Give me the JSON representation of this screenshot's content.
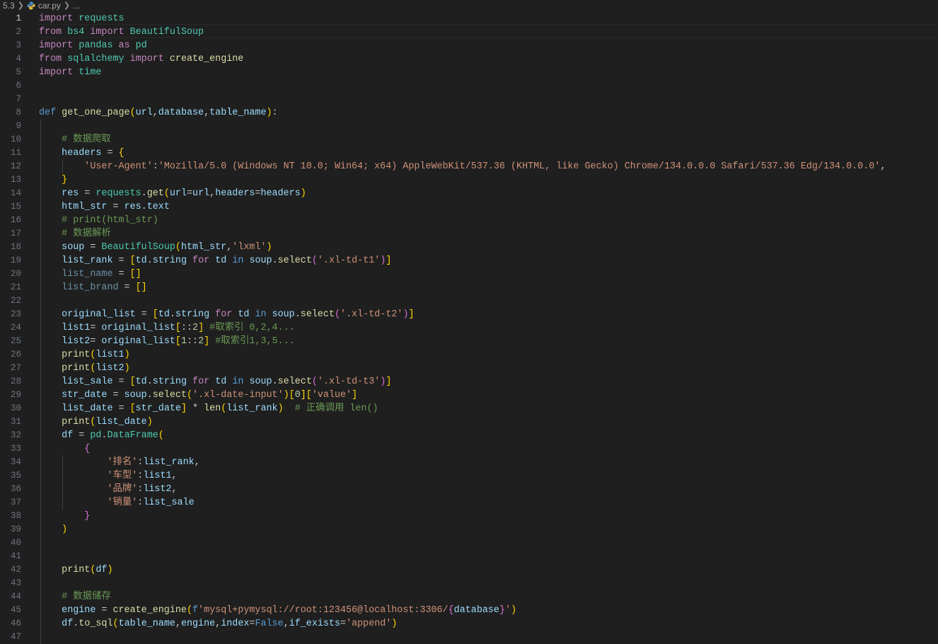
{
  "breadcrumb": {
    "folder": "5.3",
    "file": "car.py",
    "tail": "..."
  },
  "editor": {
    "active_line": 1,
    "line_numbers": [
      "1",
      "2",
      "3",
      "4",
      "5",
      "6",
      "7",
      "8",
      "9",
      "10",
      "11",
      "12",
      "13",
      "14",
      "15",
      "16",
      "17",
      "18",
      "19",
      "20",
      "21",
      "22",
      "23",
      "24",
      "25",
      "26",
      "27",
      "28",
      "29",
      "30",
      "31",
      "32",
      "33",
      "34",
      "35",
      "36",
      "37",
      "38",
      "39",
      "40",
      "41",
      "42",
      "43",
      "44",
      "45",
      "46",
      "47"
    ],
    "lines": [
      [
        [
          "kwc",
          "import"
        ],
        [
          "tx",
          " "
        ],
        [
          "mod",
          "requests"
        ]
      ],
      [
        [
          "kwc",
          "from"
        ],
        [
          "tx",
          " "
        ],
        [
          "mod",
          "bs4"
        ],
        [
          "tx",
          " "
        ],
        [
          "kwc",
          "import"
        ],
        [
          "tx",
          " "
        ],
        [
          "mod",
          "BeautifulSoup"
        ]
      ],
      [
        [
          "kwc",
          "import"
        ],
        [
          "tx",
          " "
        ],
        [
          "mod",
          "pandas"
        ],
        [
          "tx",
          " "
        ],
        [
          "kwc",
          "as"
        ],
        [
          "tx",
          " "
        ],
        [
          "mod",
          "pd"
        ]
      ],
      [
        [
          "kwc",
          "from"
        ],
        [
          "tx",
          " "
        ],
        [
          "mod",
          "sqlalchemy"
        ],
        [
          "tx",
          " "
        ],
        [
          "kwc",
          "import"
        ],
        [
          "tx",
          " "
        ],
        [
          "fn",
          "create_engine"
        ]
      ],
      [
        [
          "kwc",
          "import"
        ],
        [
          "tx",
          " "
        ],
        [
          "mod",
          "time"
        ]
      ],
      [],
      [],
      [
        [
          "kw",
          "def"
        ],
        [
          "tx",
          " "
        ],
        [
          "fn",
          "get_one_page"
        ],
        [
          "p1",
          "("
        ],
        [
          "var",
          "url"
        ],
        [
          "tx",
          ","
        ],
        [
          "var",
          "database"
        ],
        [
          "tx",
          ","
        ],
        [
          "var",
          "table_name"
        ],
        [
          "p1",
          ")"
        ],
        [
          "tx",
          ":"
        ]
      ],
      [],
      [
        [
          "tx",
          "    "
        ],
        [
          "cm",
          "# 数据爬取"
        ]
      ],
      [
        [
          "tx",
          "    "
        ],
        [
          "var",
          "headers"
        ],
        [
          "tx",
          " = "
        ],
        [
          "p1",
          "{"
        ]
      ],
      [
        [
          "tx",
          "        "
        ],
        [
          "str",
          "'User-Agent'"
        ],
        [
          "tx",
          ":"
        ],
        [
          "str",
          "'Mozilla/5.0 (Windows NT 10.0; Win64; x64) AppleWebKit/537.36 (KHTML, like Gecko) Chrome/134.0.0.0 Safari/537.36 Edg/134.0.0.0'"
        ],
        [
          "tx",
          ","
        ]
      ],
      [
        [
          "tx",
          "    "
        ],
        [
          "p1",
          "}"
        ]
      ],
      [
        [
          "tx",
          "    "
        ],
        [
          "var",
          "res"
        ],
        [
          "tx",
          " = "
        ],
        [
          "mod",
          "requests"
        ],
        [
          "tx",
          "."
        ],
        [
          "fn",
          "get"
        ],
        [
          "p1",
          "("
        ],
        [
          "var",
          "url"
        ],
        [
          "tx",
          "="
        ],
        [
          "var",
          "url"
        ],
        [
          "tx",
          ","
        ],
        [
          "var",
          "headers"
        ],
        [
          "tx",
          "="
        ],
        [
          "var",
          "headers"
        ],
        [
          "p1",
          ")"
        ]
      ],
      [
        [
          "tx",
          "    "
        ],
        [
          "var",
          "html_str"
        ],
        [
          "tx",
          " = "
        ],
        [
          "var",
          "res"
        ],
        [
          "tx",
          "."
        ],
        [
          "var",
          "text"
        ]
      ],
      [
        [
          "tx",
          "    "
        ],
        [
          "cm",
          "# print(html_str)"
        ]
      ],
      [
        [
          "tx",
          "    "
        ],
        [
          "cm",
          "# 数据解析"
        ]
      ],
      [
        [
          "tx",
          "    "
        ],
        [
          "var",
          "soup"
        ],
        [
          "tx",
          " = "
        ],
        [
          "mod",
          "BeautifulSoup"
        ],
        [
          "p1",
          "("
        ],
        [
          "var",
          "html_str"
        ],
        [
          "tx",
          ","
        ],
        [
          "str",
          "'lxml'"
        ],
        [
          "p1",
          ")"
        ]
      ],
      [
        [
          "tx",
          "    "
        ],
        [
          "var",
          "list_rank"
        ],
        [
          "tx",
          " = "
        ],
        [
          "p1",
          "["
        ],
        [
          "var",
          "td"
        ],
        [
          "tx",
          "."
        ],
        [
          "var",
          "string"
        ],
        [
          "tx",
          " "
        ],
        [
          "kwc",
          "for"
        ],
        [
          "tx",
          " "
        ],
        [
          "var",
          "td"
        ],
        [
          "tx",
          " "
        ],
        [
          "kw",
          "in"
        ],
        [
          "tx",
          " "
        ],
        [
          "var",
          "soup"
        ],
        [
          "tx",
          "."
        ],
        [
          "fn",
          "select"
        ],
        [
          "p2",
          "("
        ],
        [
          "str",
          "'.xl-td-t1'"
        ],
        [
          "p2",
          ")"
        ],
        [
          "p1",
          "]"
        ]
      ],
      [
        [
          "tx",
          "    "
        ],
        [
          "dim",
          "list_name"
        ],
        [
          "tx",
          " = "
        ],
        [
          "p1",
          "[]"
        ]
      ],
      [
        [
          "tx",
          "    "
        ],
        [
          "dim",
          "list_brand"
        ],
        [
          "tx",
          " = "
        ],
        [
          "p1",
          "[]"
        ]
      ],
      [],
      [
        [
          "tx",
          "    "
        ],
        [
          "var",
          "original_list"
        ],
        [
          "tx",
          " = "
        ],
        [
          "p1",
          "["
        ],
        [
          "var",
          "td"
        ],
        [
          "tx",
          "."
        ],
        [
          "var",
          "string"
        ],
        [
          "tx",
          " "
        ],
        [
          "kwc",
          "for"
        ],
        [
          "tx",
          " "
        ],
        [
          "var",
          "td"
        ],
        [
          "tx",
          " "
        ],
        [
          "kw",
          "in"
        ],
        [
          "tx",
          " "
        ],
        [
          "var",
          "soup"
        ],
        [
          "tx",
          "."
        ],
        [
          "fn",
          "select"
        ],
        [
          "p2",
          "("
        ],
        [
          "str",
          "'.xl-td-t2'"
        ],
        [
          "p2",
          ")"
        ],
        [
          "p1",
          "]"
        ]
      ],
      [
        [
          "tx",
          "    "
        ],
        [
          "var",
          "list1"
        ],
        [
          "tx",
          "= "
        ],
        [
          "var",
          "original_list"
        ],
        [
          "p1",
          "["
        ],
        [
          "tx",
          "::"
        ],
        [
          "num",
          "2"
        ],
        [
          "p1",
          "]"
        ],
        [
          "tx",
          " "
        ],
        [
          "cm",
          "#取索引 0,2,4..."
        ]
      ],
      [
        [
          "tx",
          "    "
        ],
        [
          "var",
          "list2"
        ],
        [
          "tx",
          "= "
        ],
        [
          "var",
          "original_list"
        ],
        [
          "p1",
          "["
        ],
        [
          "num",
          "1"
        ],
        [
          "tx",
          "::"
        ],
        [
          "num",
          "2"
        ],
        [
          "p1",
          "]"
        ],
        [
          "tx",
          " "
        ],
        [
          "cm",
          "#取索引1,3,5..."
        ]
      ],
      [
        [
          "tx",
          "    "
        ],
        [
          "fn",
          "print"
        ],
        [
          "p1",
          "("
        ],
        [
          "var",
          "list1"
        ],
        [
          "p1",
          ")"
        ]
      ],
      [
        [
          "tx",
          "    "
        ],
        [
          "fn",
          "print"
        ],
        [
          "p1",
          "("
        ],
        [
          "var",
          "list2"
        ],
        [
          "p1",
          ")"
        ]
      ],
      [
        [
          "tx",
          "    "
        ],
        [
          "var",
          "list_sale"
        ],
        [
          "tx",
          " = "
        ],
        [
          "p1",
          "["
        ],
        [
          "var",
          "td"
        ],
        [
          "tx",
          "."
        ],
        [
          "var",
          "string"
        ],
        [
          "tx",
          " "
        ],
        [
          "kwc",
          "for"
        ],
        [
          "tx",
          " "
        ],
        [
          "var",
          "td"
        ],
        [
          "tx",
          " "
        ],
        [
          "kw",
          "in"
        ],
        [
          "tx",
          " "
        ],
        [
          "var",
          "soup"
        ],
        [
          "tx",
          "."
        ],
        [
          "fn",
          "select"
        ],
        [
          "p2",
          "("
        ],
        [
          "str",
          "'.xl-td-t3'"
        ],
        [
          "p2",
          ")"
        ],
        [
          "p1",
          "]"
        ]
      ],
      [
        [
          "tx",
          "    "
        ],
        [
          "var",
          "str_date"
        ],
        [
          "tx",
          " = "
        ],
        [
          "var",
          "soup"
        ],
        [
          "tx",
          "."
        ],
        [
          "fn",
          "select"
        ],
        [
          "p1",
          "("
        ],
        [
          "str",
          "'.xl-date-input'"
        ],
        [
          "p1",
          ")"
        ],
        [
          "p1",
          "["
        ],
        [
          "num",
          "0"
        ],
        [
          "p1",
          "]"
        ],
        [
          "p1",
          "["
        ],
        [
          "str",
          "'value'"
        ],
        [
          "p1",
          "]"
        ]
      ],
      [
        [
          "tx",
          "    "
        ],
        [
          "var",
          "list_date"
        ],
        [
          "tx",
          " = "
        ],
        [
          "p1",
          "["
        ],
        [
          "var",
          "str_date"
        ],
        [
          "p1",
          "]"
        ],
        [
          "tx",
          " * "
        ],
        [
          "fn",
          "len"
        ],
        [
          "p1",
          "("
        ],
        [
          "var",
          "list_rank"
        ],
        [
          "p1",
          ")"
        ],
        [
          "tx",
          "  "
        ],
        [
          "cm",
          "# 正确调用 len()"
        ]
      ],
      [
        [
          "tx",
          "    "
        ],
        [
          "fn",
          "print"
        ],
        [
          "p1",
          "("
        ],
        [
          "var",
          "list_date"
        ],
        [
          "p1",
          ")"
        ]
      ],
      [
        [
          "tx",
          "    "
        ],
        [
          "var",
          "df"
        ],
        [
          "tx",
          " = "
        ],
        [
          "mod",
          "pd"
        ],
        [
          "tx",
          "."
        ],
        [
          "mod",
          "DataFrame"
        ],
        [
          "p1",
          "("
        ]
      ],
      [
        [
          "tx",
          "        "
        ],
        [
          "p2",
          "{"
        ]
      ],
      [
        [
          "tx",
          "            "
        ],
        [
          "str",
          "'排名'"
        ],
        [
          "tx",
          ":"
        ],
        [
          "var",
          "list_rank"
        ],
        [
          "tx",
          ","
        ]
      ],
      [
        [
          "tx",
          "            "
        ],
        [
          "str",
          "'车型'"
        ],
        [
          "tx",
          ":"
        ],
        [
          "var",
          "list1"
        ],
        [
          "tx",
          ","
        ]
      ],
      [
        [
          "tx",
          "            "
        ],
        [
          "str",
          "'品牌'"
        ],
        [
          "tx",
          ":"
        ],
        [
          "var",
          "list2"
        ],
        [
          "tx",
          ","
        ]
      ],
      [
        [
          "tx",
          "            "
        ],
        [
          "str",
          "'销量'"
        ],
        [
          "tx",
          ":"
        ],
        [
          "var",
          "list_sale"
        ]
      ],
      [
        [
          "tx",
          "        "
        ],
        [
          "p2",
          "}"
        ]
      ],
      [
        [
          "tx",
          "    "
        ],
        [
          "p1",
          ")"
        ]
      ],
      [],
      [],
      [
        [
          "tx",
          "    "
        ],
        [
          "fn",
          "print"
        ],
        [
          "p1",
          "("
        ],
        [
          "var",
          "df"
        ],
        [
          "p1",
          ")"
        ]
      ],
      [],
      [
        [
          "tx",
          "    "
        ],
        [
          "cm",
          "# 数据储存"
        ]
      ],
      [
        [
          "tx",
          "    "
        ],
        [
          "var",
          "engine"
        ],
        [
          "tx",
          " = "
        ],
        [
          "fn",
          "create_engine"
        ],
        [
          "p1",
          "("
        ],
        [
          "kw",
          "f"
        ],
        [
          "str",
          "'mysql+pymysql://root:123456@localhost:3306/"
        ],
        [
          "p2",
          "{"
        ],
        [
          "var",
          "database"
        ],
        [
          "p2",
          "}"
        ],
        [
          "str",
          "'"
        ],
        [
          "p1",
          ")"
        ]
      ],
      [
        [
          "tx",
          "    "
        ],
        [
          "var",
          "df"
        ],
        [
          "tx",
          "."
        ],
        [
          "fn",
          "to_sql"
        ],
        [
          "p1",
          "("
        ],
        [
          "var",
          "table_name"
        ],
        [
          "tx",
          ","
        ],
        [
          "var",
          "engine"
        ],
        [
          "tx",
          ","
        ],
        [
          "var",
          "index"
        ],
        [
          "tx",
          "="
        ],
        [
          "kw",
          "False"
        ],
        [
          "tx",
          ","
        ],
        [
          "var",
          "if_exists"
        ],
        [
          "tx",
          "="
        ],
        [
          "str",
          "'append'"
        ],
        [
          "p1",
          ")"
        ]
      ],
      []
    ]
  }
}
